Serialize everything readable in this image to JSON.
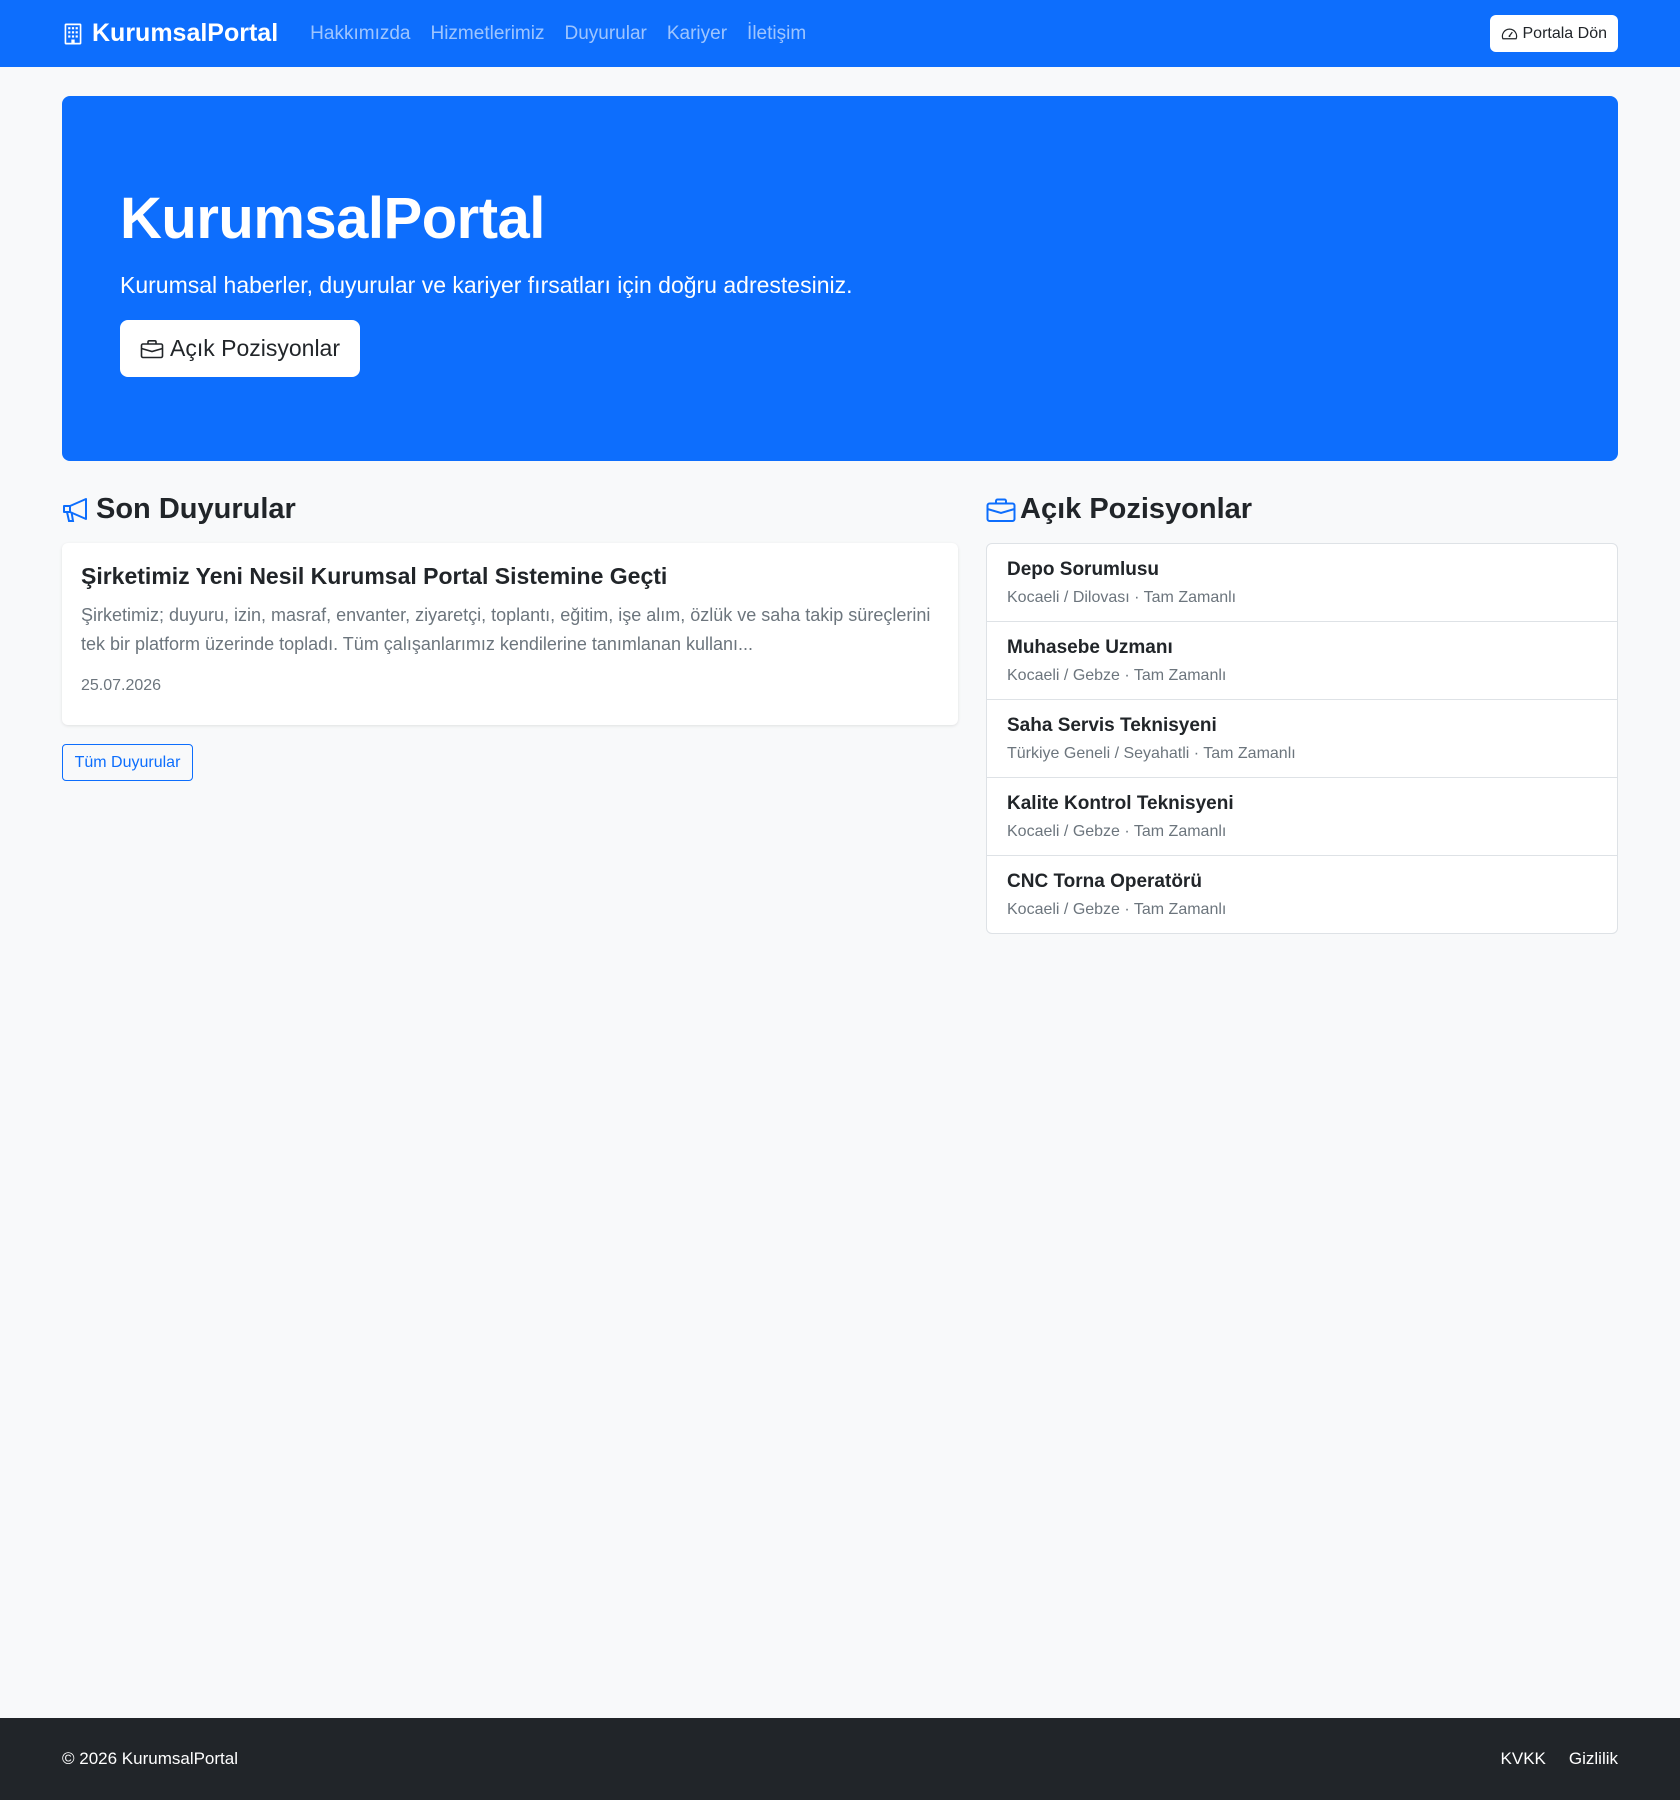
{
  "navbar": {
    "brand": "KurumsalPortal",
    "brand_icon": "building-icon",
    "links": [
      "Hakkımızda",
      "Hizmetlerimiz",
      "Duyurular",
      "Kariyer",
      "İletişim"
    ],
    "portal_button": "Portala Dön",
    "portal_icon": "speedometer-icon"
  },
  "hero": {
    "title": "KurumsalPortal",
    "subtitle": "Kurumsal haberler, duyurular ve kariyer fırsatları için doğru adrestesiniz.",
    "button": "Açık Pozisyonlar"
  },
  "announcements": {
    "heading": "Son Duyurular",
    "items": [
      {
        "title": "Şirketimiz Yeni Nesil Kurumsal Portal Sistemine Geçti",
        "body": "Şirketimiz; duyuru, izin, masraf, envanter, ziyaretçi, toplantı, eğitim, işe alım, özlük ve saha takip süreçlerini tek bir platform üzerinde topladı. Tüm çalışanlarımız kendilerine tanımlanan kullanı...",
        "date": "25.07.2026"
      }
    ],
    "all_button": "Tüm Duyurular"
  },
  "positions": {
    "heading": "Açık Pozisyonlar",
    "items": [
      {
        "title": "Depo Sorumlusu",
        "meta": "Kocaeli / Dilovası · Tam Zamanlı"
      },
      {
        "title": "Muhasebe Uzmanı",
        "meta": "Kocaeli / Gebze · Tam Zamanlı"
      },
      {
        "title": "Saha Servis Teknisyeni",
        "meta": "Türkiye Geneli / Seyahatli · Tam Zamanlı"
      },
      {
        "title": "Kalite Kontrol Teknisyeni",
        "meta": "Kocaeli / Gebze · Tam Zamanlı"
      },
      {
        "title": "CNC Torna Operatörü",
        "meta": "Kocaeli / Gebze · Tam Zamanlı"
      }
    ]
  },
  "footer": {
    "copyright": "© 2026 KurumsalPortal",
    "links": [
      "KVKK",
      "Gizlilik"
    ]
  },
  "colors": {
    "primary": "#0d6efd",
    "background": "#f8f9fa",
    "footer": "#212529",
    "muted": "#6c757d"
  }
}
